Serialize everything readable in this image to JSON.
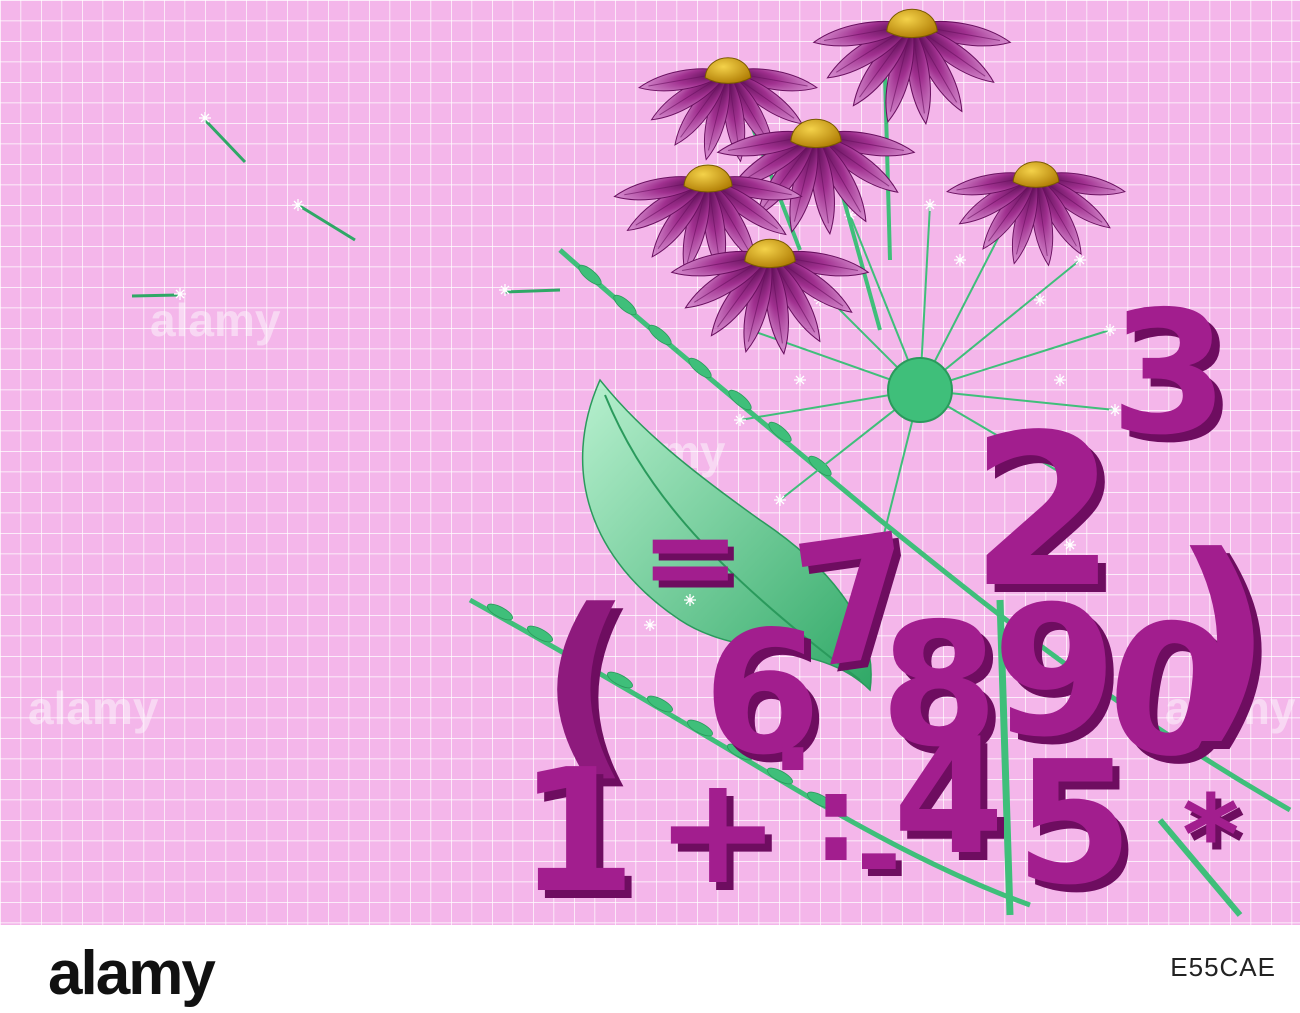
{
  "image": {
    "watermark_text": "alamy",
    "glyphs": [
      "3",
      "2",
      "7",
      "=",
      "(",
      "6",
      ".",
      "8",
      "9",
      "0",
      ")",
      "1",
      "+",
      ".",
      "4",
      "5",
      "*",
      ":",
      "-"
    ]
  },
  "footer": {
    "brand": "alamy",
    "photo_id": "E55CAE"
  },
  "colors": {
    "background_grid": "#f4b6ea",
    "grid_line": "#ffffff",
    "petal": "#9b2a8e",
    "petal_light": "#c84fb8",
    "flower_center": "#d6a40f",
    "leaf": "#3fbf7a",
    "numerals": "#a21e8e",
    "numerals_shadow": "#6e0d60"
  }
}
